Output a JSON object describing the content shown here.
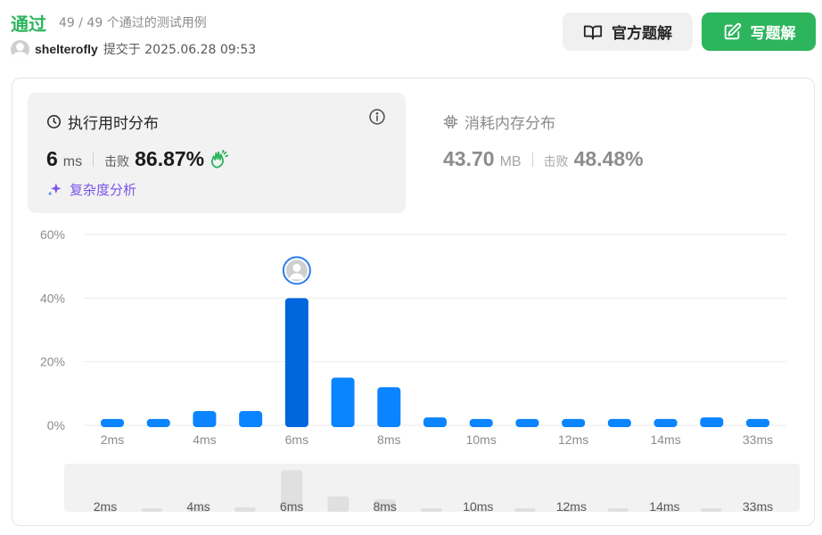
{
  "header": {
    "status": "通过",
    "test_count": "49 / 49 个通过的测试用例",
    "author": "shelterofly",
    "submitted": "提交于 2025.06.28 09:53",
    "official_solution_label": "官方题解",
    "write_solution_label": "写题解"
  },
  "runtime": {
    "title": "执行用时分布",
    "value": "6",
    "unit": "ms",
    "beat_label": "击败",
    "beat_pct": "86.87%",
    "analysis_label": "复杂度分析",
    "info_icon": "info-icon",
    "clock_icon": "clock-icon",
    "clap_icon": "clap-icon",
    "sparkle_icon": "sparkle-icon"
  },
  "memory": {
    "title": "消耗内存分布",
    "value": "43.70",
    "unit": "MB",
    "beat_label": "击败",
    "beat_pct": "48.48%",
    "chip_icon": "chip-icon"
  },
  "colors": {
    "accent_green": "#2db55d",
    "bar_blue": "#0a84ff",
    "bar_selected": "#0066dd",
    "purple": "#7a55e8",
    "navigator_bar": "#e0e0e0"
  },
  "chart_data": {
    "type": "bar",
    "y_ticks": [
      "60%",
      "40%",
      "20%",
      "0%"
    ],
    "ylim": [
      0,
      60
    ],
    "grid": true,
    "x_tick_labels": [
      "2ms",
      "4ms",
      "6ms",
      "8ms",
      "10ms",
      "12ms",
      "14ms",
      "33ms"
    ],
    "values": [
      2,
      2,
      4.5,
      4.5,
      40,
      15,
      12,
      2.5,
      2,
      2,
      2,
      2,
      2,
      2.5,
      2
    ],
    "selected_index": 4,
    "navigator": {
      "x_tick_labels": [
        "2ms",
        "4ms",
        "6ms",
        "8ms",
        "10ms",
        "12ms",
        "14ms",
        "33ms"
      ]
    }
  }
}
